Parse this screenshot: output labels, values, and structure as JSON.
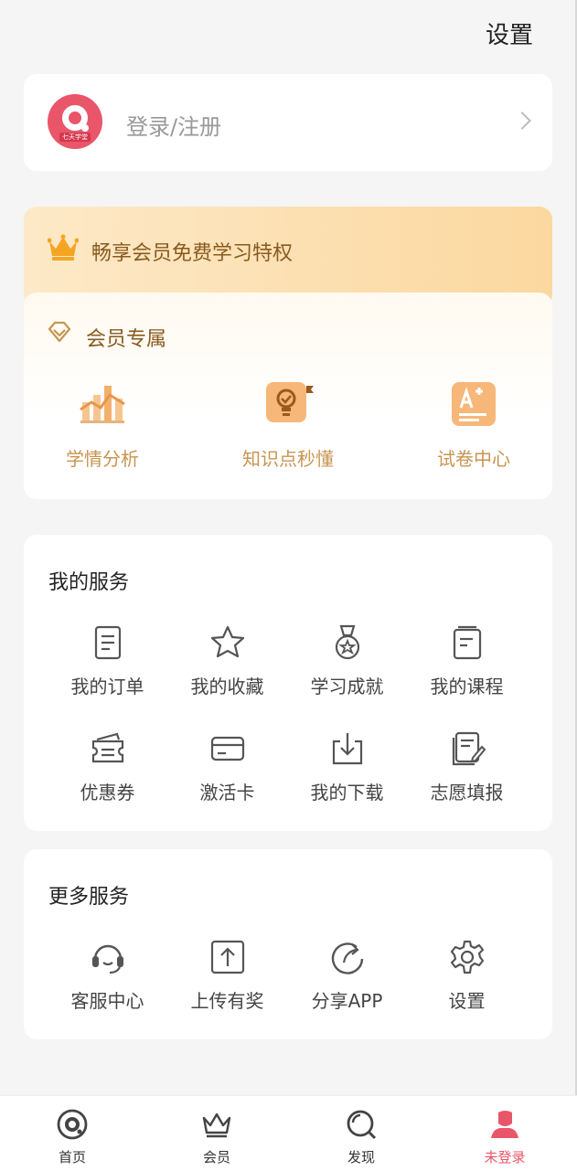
{
  "header": {
    "settings_label": "设置"
  },
  "login": {
    "text": "登录/注册",
    "brand_text": "七天学堂"
  },
  "vip": {
    "banner_title": "畅享会员免费学习特权",
    "section_title": "会员专属",
    "items": [
      {
        "label": "学情分析",
        "icon": "chart-icon"
      },
      {
        "label": "知识点秒懂",
        "icon": "lightbulb-icon"
      },
      {
        "label": "试卷中心",
        "icon": "exam-icon"
      }
    ]
  },
  "my_services": {
    "title": "我的服务",
    "items": [
      {
        "label": "我的订单",
        "icon": "order-icon"
      },
      {
        "label": "我的收藏",
        "icon": "star-icon"
      },
      {
        "label": "学习成就",
        "icon": "medal-icon"
      },
      {
        "label": "我的课程",
        "icon": "course-icon"
      },
      {
        "label": "优惠券",
        "icon": "coupon-icon"
      },
      {
        "label": "激活卡",
        "icon": "card-icon"
      },
      {
        "label": "我的下载",
        "icon": "download-icon"
      },
      {
        "label": "志愿填报",
        "icon": "form-edit-icon"
      }
    ]
  },
  "more_services": {
    "title": "更多服务",
    "items": [
      {
        "label": "客服中心",
        "icon": "headset-icon"
      },
      {
        "label": "上传有奖",
        "icon": "upload-icon"
      },
      {
        "label": "分享APP",
        "icon": "share-icon"
      },
      {
        "label": "设置",
        "icon": "gear-icon"
      }
    ]
  },
  "tabbar": {
    "items": [
      {
        "label": "首页",
        "icon": "home-icon"
      },
      {
        "label": "会员",
        "icon": "crown-icon"
      },
      {
        "label": "发现",
        "icon": "discover-icon"
      },
      {
        "label": "未登录",
        "icon": "user-icon"
      }
    ],
    "active_index": 3
  },
  "colors": {
    "accent": "#e9566a",
    "gold": "#c79550",
    "gold_dark": "#8a5a1e"
  }
}
